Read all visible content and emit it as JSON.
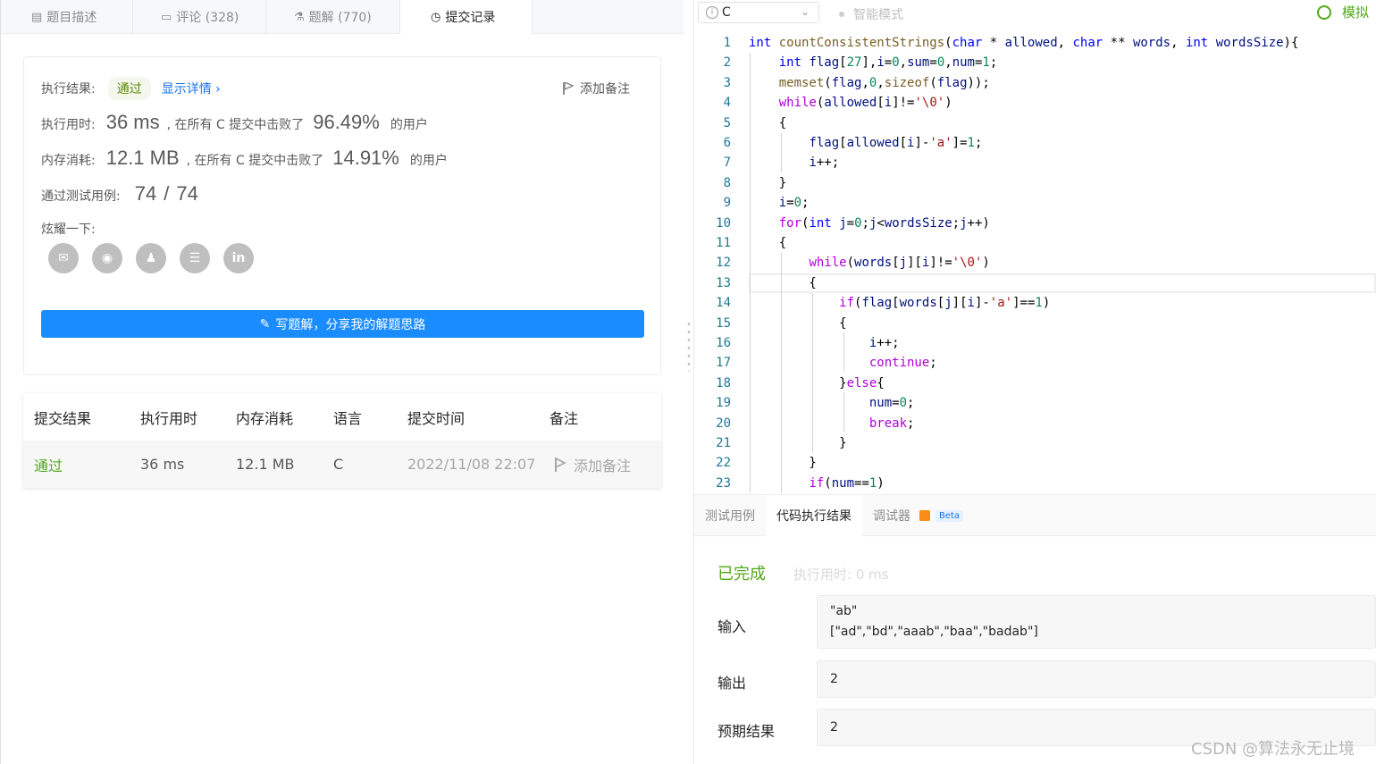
{
  "left_tabs": [
    {
      "label": "题目描述",
      "icon": "description-icon"
    },
    {
      "label": "评论 (328)",
      "icon": "comment-icon"
    },
    {
      "label": "题解 (770)",
      "icon": "flask-icon"
    },
    {
      "label": "提交记录",
      "icon": "clock-icon"
    }
  ],
  "result": {
    "exec_result_label": "执行结果:",
    "status": "通过",
    "details_link": "显示详情 ›",
    "add_note": "添加备注",
    "time_label": "执行用时:",
    "time_value": "36 ms",
    "time_text": ", 在所有 C 提交中击败了",
    "time_pct": "96.49%",
    "users": "的用户",
    "mem_label": "内存消耗:",
    "mem_value": "12.1 MB",
    "mem_text": ", 在所有 C 提交中击败了",
    "mem_pct": "14.91%",
    "tests_label": "通过测试用例:",
    "tests_passed": "74",
    "tests_sep": "/",
    "tests_total": "74",
    "share_label": "炫耀一下:",
    "share_icons": [
      "wechat-icon",
      "weibo-icon",
      "qq-icon",
      "douban-icon",
      "linkedin-icon"
    ],
    "share_glyphs": [
      "✉",
      "◉",
      "♟",
      "☰",
      "in"
    ],
    "write_button": "写题解，分享我的解题思路"
  },
  "submissions": {
    "headers": [
      "提交结果",
      "执行用时",
      "内存消耗",
      "语言",
      "提交时间",
      "备注"
    ],
    "rows": [
      {
        "result": "通过",
        "time": "36 ms",
        "memory": "12.1 MB",
        "lang": "C",
        "submitted": "2022/11/08 22:07",
        "note": "添加备注"
      }
    ]
  },
  "editor_bar": {
    "language": "C",
    "language_icon": "info-icon",
    "smart_mode": "智能模式",
    "mock_label": "模拟"
  },
  "code_lines": [
    "int countConsistentStrings(char * allowed, char ** words, int wordsSize){",
    "    int flag[27],i=0,sum=0,num=1;",
    "    memset(flag,0,sizeof(flag));",
    "    while(allowed[i]!='\\0')",
    "    {",
    "        flag[allowed[i]-'a']=1;",
    "        i++;",
    "    }",
    "    i=0;",
    "    for(int j=0;j<wordsSize;j++)",
    "    {",
    "        while(words[j][i]!='\\0')",
    "        {",
    "            if(flag[words[j][i]-'a']==1)",
    "            {",
    "                i++;",
    "                continue;",
    "            }else{",
    "                num=0;",
    "                break;",
    "            }",
    "        }",
    "        if(num==1)"
  ],
  "line_numbers": [
    "1",
    "2",
    "3",
    "4",
    "5",
    "6",
    "7",
    "8",
    "9",
    "10",
    "11",
    "12",
    "13",
    "14",
    "15",
    "16",
    "17",
    "18",
    "19",
    "20",
    "21",
    "22",
    "23"
  ],
  "panel": {
    "tabs": [
      "测试用例",
      "代码执行结果",
      "调试器"
    ],
    "beta": "Beta",
    "status": "已完成",
    "runtime": "执行用时: 0 ms",
    "input_label": "输入",
    "input_line1": "\"ab\"",
    "input_line2": "[\"ad\",\"bd\",\"aaab\",\"baa\",\"badab\"]",
    "output_label": "输出",
    "output_value": "2",
    "expected_label": "预期结果",
    "expected_value": "2"
  },
  "watermark": "CSDN @算法永无止境",
  "colors": {
    "accent": "#1a8cff",
    "success": "#52a81a",
    "keyword": "#0000ff",
    "control": "#af00db"
  }
}
